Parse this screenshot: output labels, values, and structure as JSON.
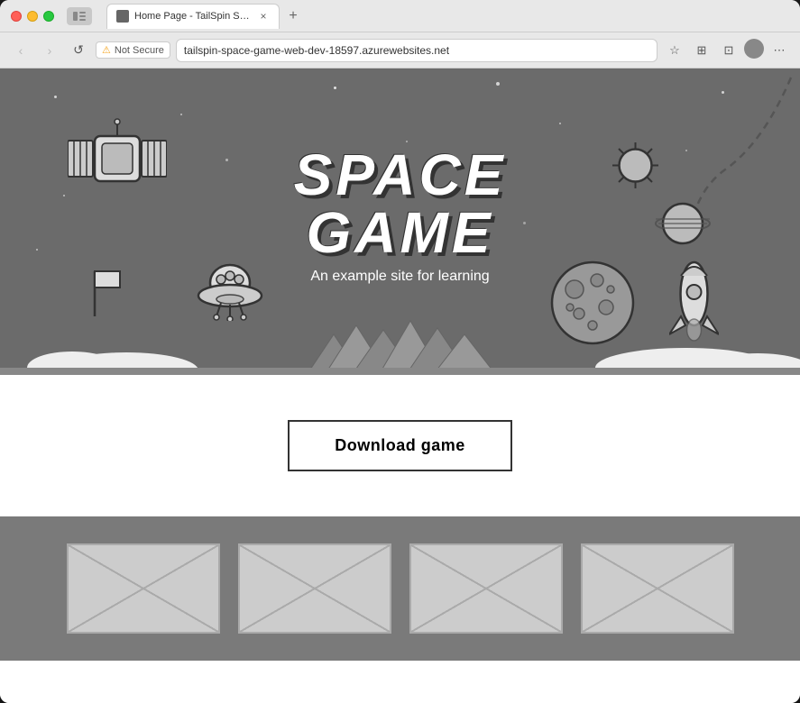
{
  "browser": {
    "tab_title": "Home Page - TailSpin SpaceGa...",
    "tab_close": "×",
    "tab_new": "+",
    "url": "tailspin-space-game-web-dev-18597.azurewebsites.net",
    "security_label": "Not Secure",
    "nav_back": "‹",
    "nav_forward": "›",
    "nav_reload": "↺"
  },
  "hero": {
    "title_line1": "SPACE",
    "title_line2": "GAME",
    "subtitle": "An example site for learning"
  },
  "download": {
    "button_label": "Download game"
  },
  "placeholder_cards": [
    {
      "id": "card-1"
    },
    {
      "id": "card-2"
    },
    {
      "id": "card-3"
    },
    {
      "id": "card-4"
    }
  ],
  "icons": {
    "star": "★",
    "bookmark": "☆",
    "share": "⊡",
    "menu": "⋯",
    "warning": "⚠"
  }
}
